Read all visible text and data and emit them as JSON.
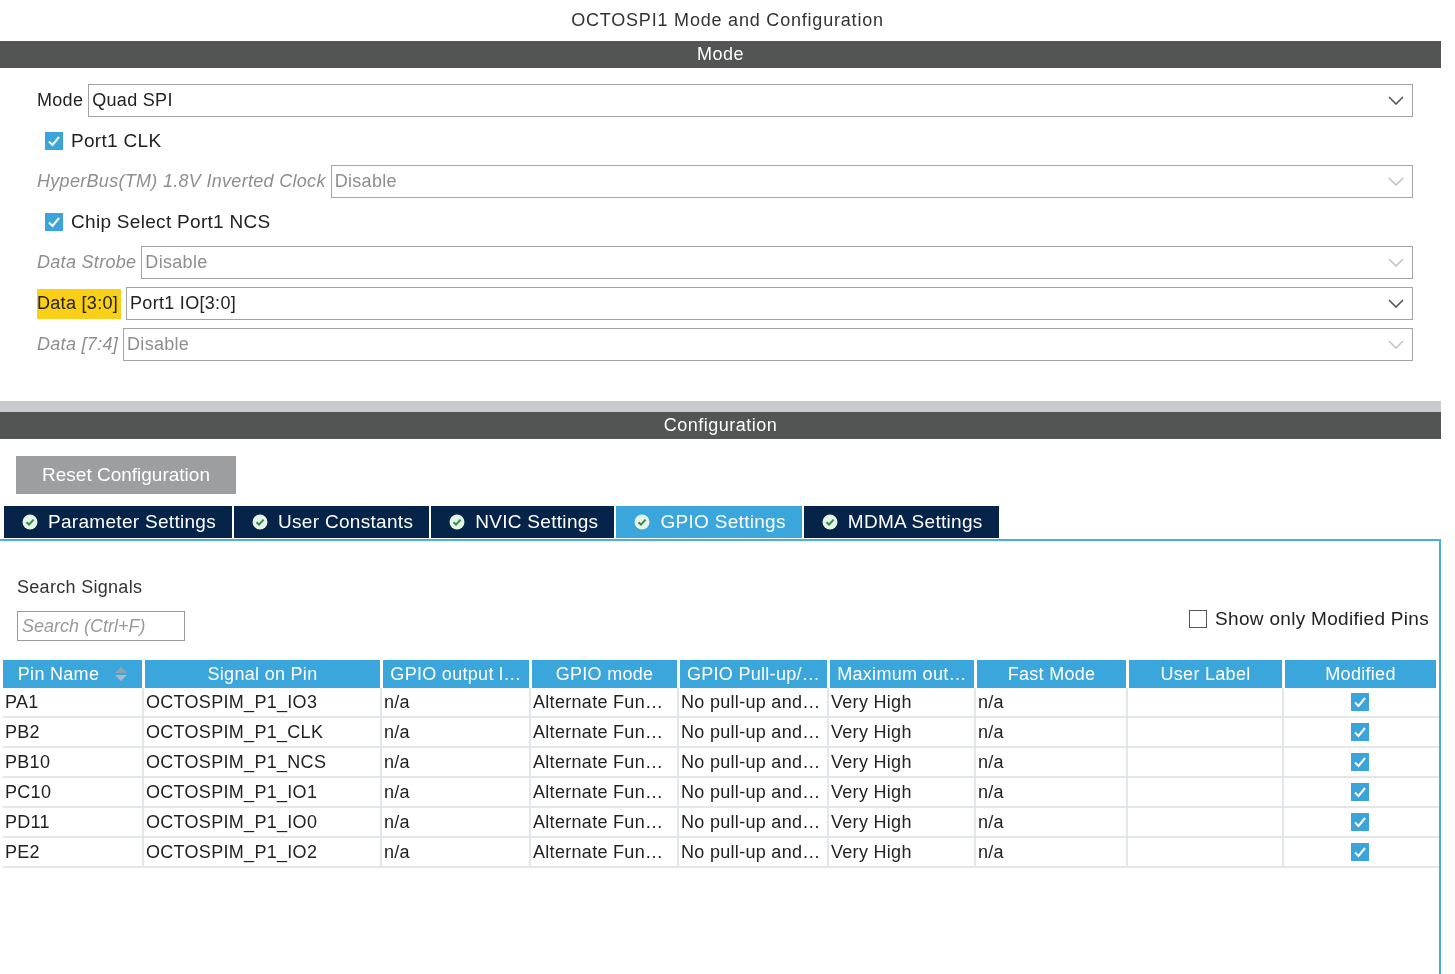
{
  "window": {
    "title": "OCTOSPI1 Mode and Configuration"
  },
  "mode_section": {
    "header": "Mode",
    "fields": [
      {
        "kind": "select",
        "label": "Mode",
        "value": "Quad SPI",
        "disabled": false,
        "highlighted": false
      },
      {
        "kind": "checkbox",
        "label": "Port1 CLK",
        "checked": true
      },
      {
        "kind": "select",
        "label": "HyperBus(TM) 1.8V Inverted Clock",
        "value": "Disable",
        "disabled": true,
        "highlighted": false
      },
      {
        "kind": "checkbox",
        "label": "Chip Select Port1 NCS",
        "checked": true
      },
      {
        "kind": "select",
        "label": "Data Strobe",
        "value": "Disable",
        "disabled": true,
        "highlighted": false
      },
      {
        "kind": "select",
        "label": "Data [3:0]",
        "value": "Port1 IO[3:0]",
        "disabled": false,
        "highlighted": true
      },
      {
        "kind": "select",
        "label": "Data [7:4]",
        "value": "Disable",
        "disabled": true,
        "highlighted": false
      }
    ]
  },
  "configuration_section": {
    "header": "Configuration",
    "reset_button": "Reset Configuration",
    "tabs": [
      {
        "label": "Parameter Settings",
        "selected": false
      },
      {
        "label": "User Constants",
        "selected": false
      },
      {
        "label": "NVIC Settings",
        "selected": false
      },
      {
        "label": "GPIO Settings",
        "selected": true
      },
      {
        "label": "MDMA Settings",
        "selected": false
      }
    ],
    "search": {
      "label": "Search Signals",
      "placeholder": "Search (Ctrl+F)"
    },
    "show_only_modified": {
      "label": "Show only Modified Pins",
      "checked": false
    },
    "table": {
      "columns": [
        {
          "label": "Pin Name",
          "sorted": true
        },
        {
          "label": "Signal on Pin",
          "sorted": false
        },
        {
          "label": "GPIO output l…",
          "sorted": false
        },
        {
          "label": "GPIO mode",
          "sorted": false
        },
        {
          "label": "GPIO Pull-up/…",
          "sorted": false
        },
        {
          "label": "Maximum out…",
          "sorted": false
        },
        {
          "label": "Fast Mode",
          "sorted": false
        },
        {
          "label": "User Label",
          "sorted": false
        },
        {
          "label": "Modified",
          "sorted": false
        }
      ],
      "rows": [
        {
          "cells": [
            "PA1",
            "OCTOSPIM_P1_IO3",
            "n/a",
            "Alternate Fun…",
            "No pull-up and…",
            "Very High",
            "n/a"
          ],
          "modified": true
        },
        {
          "cells": [
            "PB2",
            "OCTOSPIM_P1_CLK",
            "n/a",
            "Alternate Fun…",
            "No pull-up and…",
            "Very High",
            "n/a"
          ],
          "modified": true
        },
        {
          "cells": [
            "PB10",
            "OCTOSPIM_P1_NCS",
            "n/a",
            "Alternate Fun…",
            "No pull-up and…",
            "Very High",
            "n/a"
          ],
          "modified": true
        },
        {
          "cells": [
            "PC10",
            "OCTOSPIM_P1_IO1",
            "n/a",
            "Alternate Fun…",
            "No pull-up and…",
            "Very High",
            "n/a"
          ],
          "modified": true
        },
        {
          "cells": [
            "PD11",
            "OCTOSPIM_P1_IO0",
            "n/a",
            "Alternate Fun…",
            "No pull-up and…",
            "Very High",
            "n/a"
          ],
          "modified": true
        },
        {
          "cells": [
            "PE2",
            "OCTOSPIM_P1_IO2",
            "n/a",
            "Alternate Fun…",
            "No pull-up and…",
            "Very High",
            "n/a"
          ],
          "modified": true
        }
      ]
    }
  }
}
